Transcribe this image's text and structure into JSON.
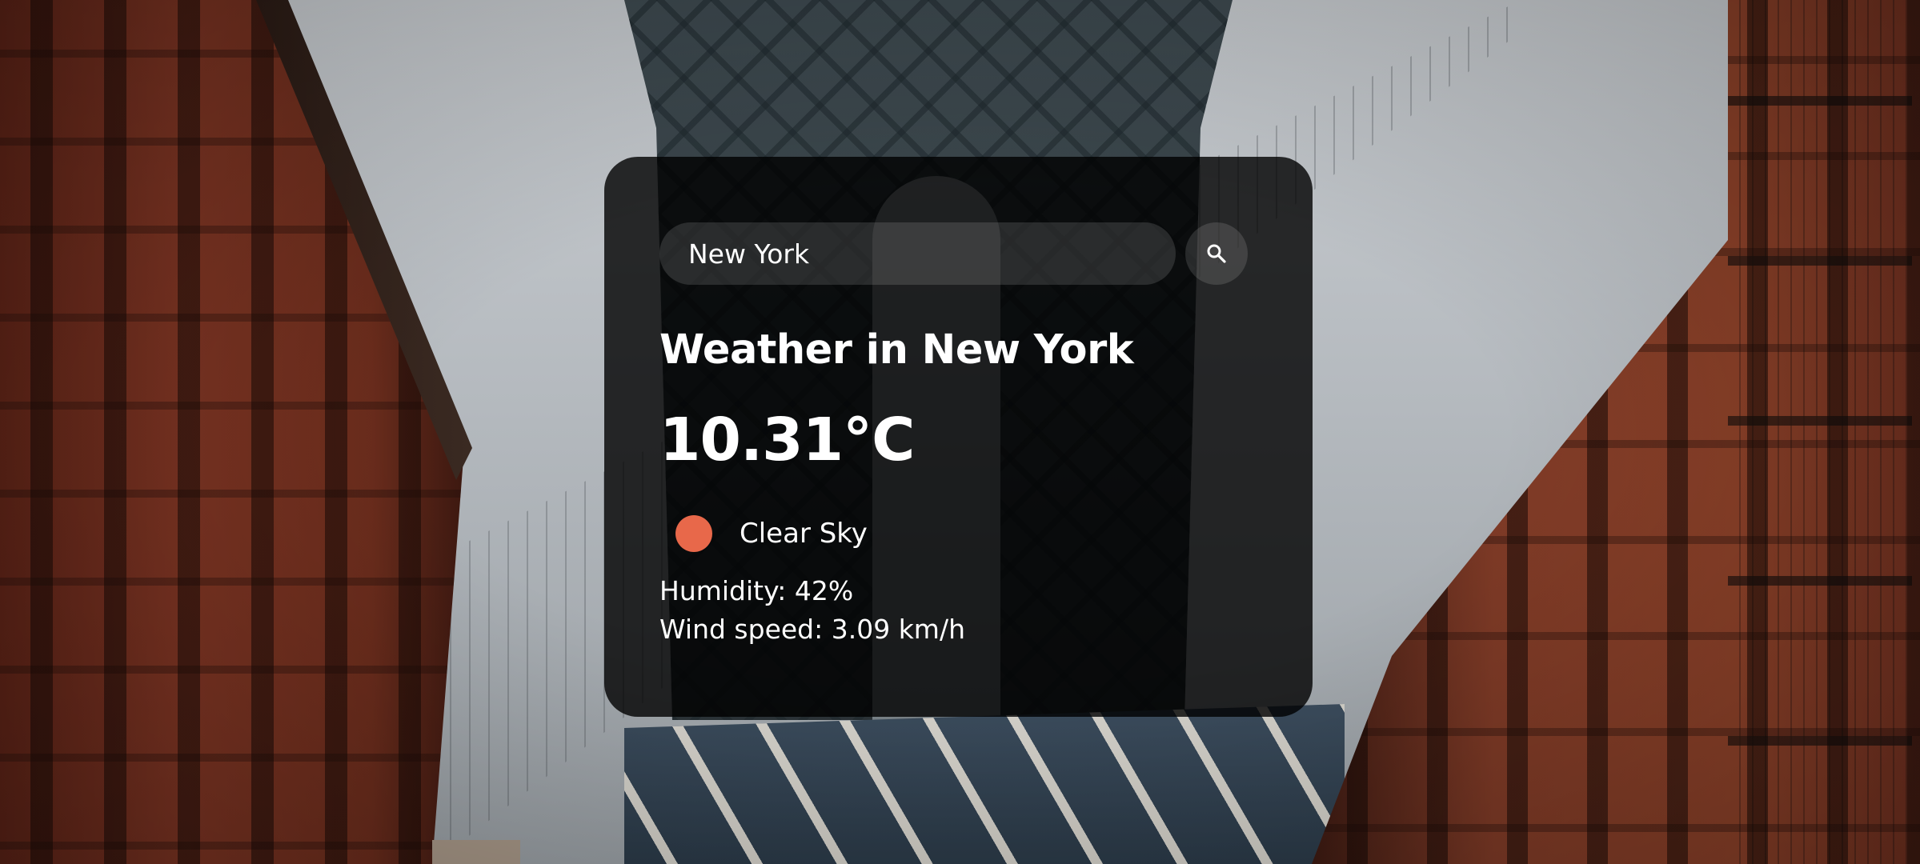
{
  "search": {
    "value": "New York",
    "button_icon": "search-icon"
  },
  "weather": {
    "title": "Weather in New York",
    "temperature": "10.31°C",
    "condition": "Clear Sky",
    "condition_icon": "sun-icon",
    "condition_icon_color": "#e8684a",
    "humidity": "Humidity: 42%",
    "wind": "Wind speed: 3.09 km/h"
  },
  "colors": {
    "card_background": "rgba(0,0,0,0.80)",
    "text": "#ffffff",
    "input_background": "rgba(255,255,255,0.13)"
  }
}
